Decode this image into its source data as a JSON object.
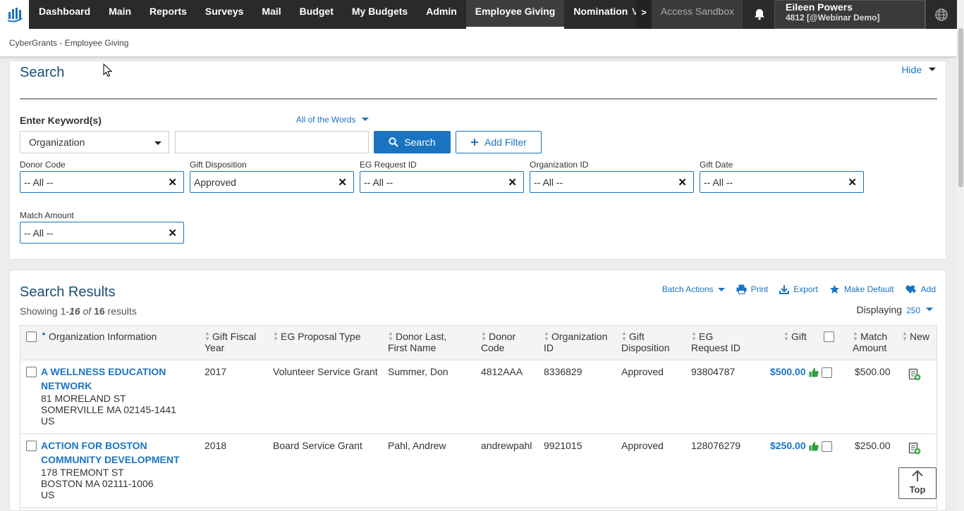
{
  "nav": {
    "items": [
      "Dashboard",
      "Main",
      "Reports",
      "Surveys",
      "Mail",
      "Budget",
      "My Budgets",
      "Admin",
      "Employee Giving",
      "Nomination"
    ],
    "overflow_label": "V",
    "more_arrow": ">",
    "sandbox": "Access Sandbox",
    "user_name": "Eileen Powers",
    "user_sub": "4812 [@Webinar Demo]"
  },
  "breadcrumb": "CyberGrants - Employee Giving",
  "search": {
    "title": "Search",
    "hide_label": "Hide",
    "keyword_label": "Enter Keyword(s)",
    "match_mode": "All of the Words",
    "field_select": "Organization",
    "search_button": "Search",
    "add_filter_button": "Add Filter",
    "filters": [
      {
        "label": "Donor Code",
        "value": "-- All --"
      },
      {
        "label": "Gift Disposition",
        "value": "Approved"
      },
      {
        "label": "EG Request ID",
        "value": "-- All --"
      },
      {
        "label": "Organization ID",
        "value": "-- All --"
      },
      {
        "label": "Gift Date",
        "value": "-- All --"
      },
      {
        "label": "Match Amount",
        "value": "-- All --"
      }
    ]
  },
  "results": {
    "title": "Search Results",
    "showing_prefix": "Showing 1-",
    "showing_to": "16",
    "showing_of": " of ",
    "showing_total": "16",
    "showing_suffix": " results",
    "actions": {
      "batch": "Batch Actions",
      "print": "Print",
      "export": "Export",
      "make_default": "Make Default",
      "add": "Add"
    },
    "displaying_label": "Displaying",
    "displaying_value": "250",
    "columns": {
      "org": "Organization Information",
      "fiscal_year": "Gift Fiscal Year",
      "proposal_type": "EG Proposal Type",
      "donor_name": "Donor Last, First Name",
      "donor_code": "Donor Code",
      "org_id": "Organization ID",
      "disposition": "Gift Disposition",
      "request_id": "EG Request ID",
      "gift": "Gift",
      "match_amount": "Match Amount",
      "new": "New"
    },
    "rows": [
      {
        "org_name_1": "A WELLNESS EDUCATION",
        "org_name_2": "NETWORK",
        "addr1": "81 MORELAND ST",
        "addr2": "SOMERVILLE MA 02145-1441",
        "country": "US",
        "fiscal_year": "2017",
        "proposal_type": "Volunteer Service Grant",
        "donor_name": "Summer, Don",
        "donor_code": "4812AAA",
        "org_id": "8336829",
        "disposition": "Approved",
        "request_id": "93804787",
        "gift": "$500.00",
        "match_amount": "$500.00"
      },
      {
        "org_name_1": "ACTION FOR BOSTON",
        "org_name_2": "COMMUNITY DEVELOPMENT",
        "addr1": "178 TREMONT ST",
        "addr2": "BOSTON MA 02111-1006",
        "country": "US",
        "fiscal_year": "2018",
        "proposal_type": "Board Service Grant",
        "donor_name": "Pahl, Andrew",
        "donor_code": "andrewpahl",
        "org_id": "9921015",
        "disposition": "Approved",
        "request_id": "128076279",
        "gift": "$250.00",
        "match_amount": "$250.00"
      }
    ]
  },
  "top_button": "Top",
  "colors": {
    "accent": "#1a74c0",
    "nav_bg": "#2a2a2a",
    "thumb_green": "#2e9e3e"
  }
}
